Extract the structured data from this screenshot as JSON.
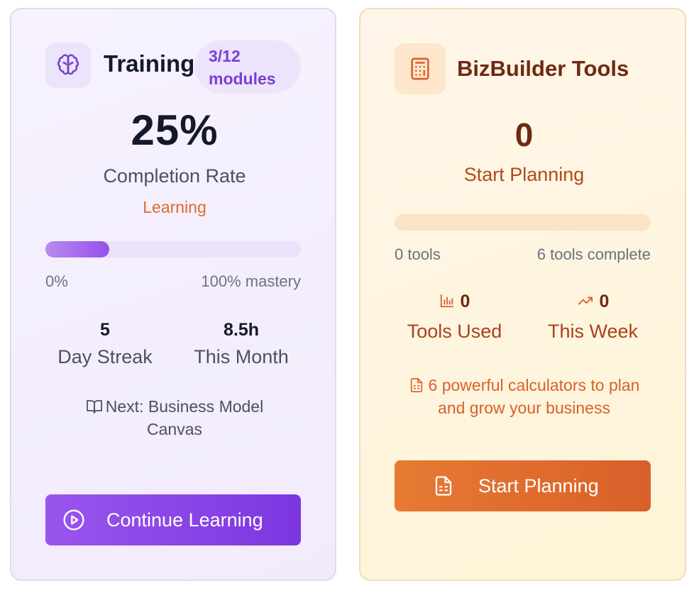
{
  "training": {
    "title": "Training",
    "badge": "3/12 modules",
    "percent": "25%",
    "subtitle": "Completion Rate",
    "status": "Learning",
    "progress_fraction": 0.25,
    "range_min": "0%",
    "range_max": "100% mastery",
    "stats": [
      {
        "value": "5",
        "label": "Day Streak"
      },
      {
        "value": "8.5h",
        "label": "This Month"
      }
    ],
    "next": "Next: Business Model Canvas",
    "button_label": "Continue Learning",
    "icons": {
      "header": "brain-icon",
      "next": "book-open-icon",
      "button": "play-circle-icon"
    },
    "colors": {
      "accent": "#7d36e0",
      "status": "#e06a2b"
    }
  },
  "bizbuilder": {
    "title": "BizBuilder Tools",
    "count": "0",
    "subtitle": "Start Planning",
    "progress_fraction": 0,
    "range_min": "0 tools",
    "range_max": "6 tools complete",
    "stats": [
      {
        "value": "0",
        "label": "Tools Used",
        "icon": "bar-chart-icon"
      },
      {
        "value": "0",
        "label": "This Week",
        "icon": "trending-up-icon"
      }
    ],
    "description": "6 powerful calculators to plan and grow your business",
    "button_label": "Start Planning",
    "icons": {
      "header": "calculator-icon",
      "description": "file-spreadsheet-icon",
      "button": "file-spreadsheet-icon"
    },
    "colors": {
      "accent": "#d9602a",
      "title": "#6e2a10"
    }
  }
}
